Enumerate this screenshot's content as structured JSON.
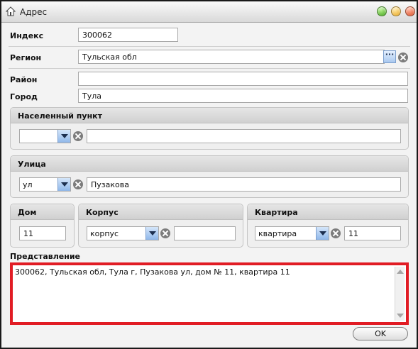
{
  "window": {
    "title": "Адрес"
  },
  "fields": {
    "index": {
      "label": "Индекс",
      "value": "300062"
    },
    "region": {
      "label": "Регион",
      "value": "Тульская обл",
      "dots": "···"
    },
    "district": {
      "label": "Район",
      "value": ""
    },
    "city": {
      "label": "Город",
      "value": "Тула"
    }
  },
  "settlement": {
    "title": "Населенный пункт",
    "type": "",
    "value": ""
  },
  "street": {
    "title": "Улица",
    "type": "ул",
    "value": "Пузакова"
  },
  "house": {
    "title": "Дом",
    "value": "11"
  },
  "building": {
    "title": "Корпус",
    "type": "корпус",
    "value": ""
  },
  "apartment": {
    "title": "Квартира",
    "type": "квартира",
    "value": "11"
  },
  "representation": {
    "label": "Представление",
    "value": "300062, Тульская обл, Тула г, Пузакова ул, дом № 11, квартира 11"
  },
  "buttons": {
    "ok": "OK"
  },
  "colors": {
    "highlight": "#e11c24",
    "accent": "#8fb7ea"
  }
}
